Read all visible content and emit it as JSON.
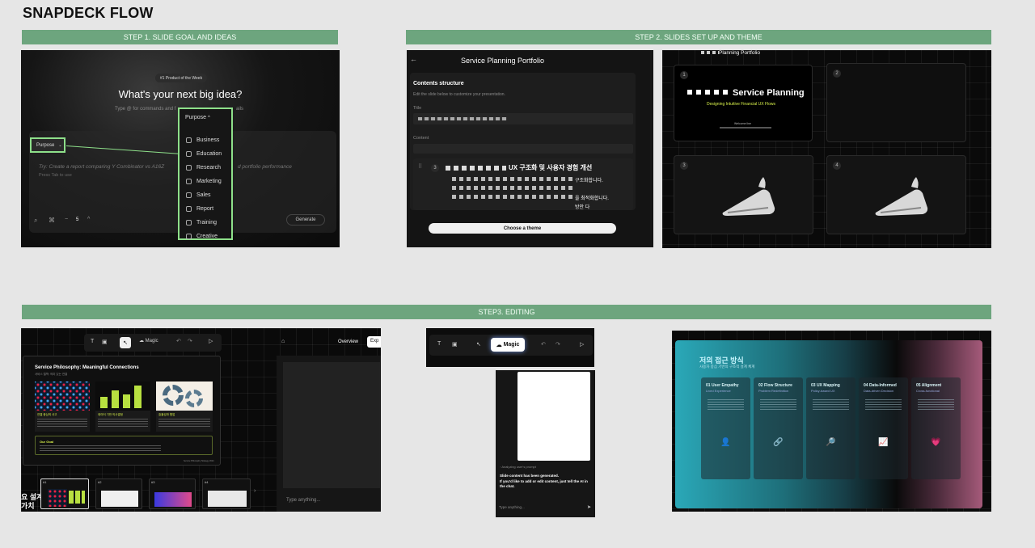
{
  "page_title": "SNAPDECK FLOW",
  "steps": {
    "step1": "STEP 1.  SLIDE GOAL AND IDEAS",
    "step2": "STEP 2. SLIDES SET UP AND THEME",
    "step3": "STEP3. EDITING"
  },
  "s1": {
    "badge": "#1 Product of the Week",
    "headline": "What's your next big idea?",
    "subline": "Type @ for commands and f",
    "subline_tail": "ails",
    "purpose_chip": "Purpose",
    "prompt_prefix": "Try:",
    "prompt": "Create a report comparing Y Combinator vs A16Z",
    "prompt_tail": "d portfolio performance",
    "tab_hint": "Press Tab to use",
    "slide_count": "5",
    "generate": "Generate",
    "dropdown_title": "Purpose",
    "dropdown_items": [
      "Business",
      "Education",
      "Research",
      "Marketing",
      "Sales",
      "Report",
      "Training",
      "Creative"
    ]
  },
  "s2a": {
    "header": "Service Planning Portfolio",
    "section": "Contents structure",
    "section_hint": "Edit the slide below to customize your presentation.",
    "title_label": "Title",
    "content_label": "Content",
    "row_num": "3",
    "row_title": "UX 구조화 및 사용자 경험 개선",
    "row_line1": "구조화합니다.",
    "row_line2": "을 최적화합니다.",
    "row_line3": "방안 다",
    "cta": "Choose a theme"
  },
  "s2b": {
    "header": "Planning Portfolio",
    "slide1_num": "1",
    "slide1_title": "Service Planning",
    "slide1_sub": "Designing Intuitive Financial UX Flows",
    "slide1_meta": "Welcome line",
    "slide2_num": "2",
    "slide3_num": "3",
    "slide4_num": "4"
  },
  "s3a": {
    "toolbar_magic": "Magic",
    "overview": "Overview",
    "export": "Exp",
    "slide_title": "Service Philosophy: Meaningful Connections",
    "slide_sub": "서비스 철학: 의미 있는 연결",
    "card1_title": "연결 중심의 사고",
    "card2_title": "데이터 기반 의사결정",
    "card3_title": "효율성과 협업",
    "goal_label": "Our Goal",
    "footer": "Service Philosophy Strategy 2024",
    "chat_placeholder": "Type anything...",
    "thumbs": [
      "#1",
      "#2",
      "#3",
      "#4"
    ],
    "big_text": "요 설계\n가치"
  },
  "s3b": {
    "toolbar_magic": "Magic",
    "analyzing": "Analyzing user's prompt",
    "generated": "Slide content has been generated.\nIf you'd like to add or edit content, just tell the AI in the chat.",
    "chat_placeholder": "Type anything..."
  },
  "s3c": {
    "title": "저의 접근 방식",
    "subtitle": "사용자 중심 기반의 구조적 설계 체계",
    "columns": [
      {
        "title": "01 User Empathy",
        "sub": "Lived Experience",
        "icon": "person-icon"
      },
      {
        "title": "02 Flow Structure",
        "sub": "Problem Redefinition",
        "icon": "link-icon"
      },
      {
        "title": "03 UX Mapping",
        "sub": "Policy-based UX",
        "icon": "search-icon"
      },
      {
        "title": "04 Data-Informed",
        "sub": "Data-driven Decision",
        "icon": "chart-icon"
      },
      {
        "title": "05 Alignment",
        "sub": "Cross-functional",
        "icon": "heart-icon"
      }
    ]
  },
  "colors": {
    "step_bar": "#6da57e",
    "highlight_green": "#8ee08a",
    "accent_yellow": "#d7f04a",
    "accent_teal": "#2ab8c4",
    "accent_pink": "#a55a7a"
  }
}
